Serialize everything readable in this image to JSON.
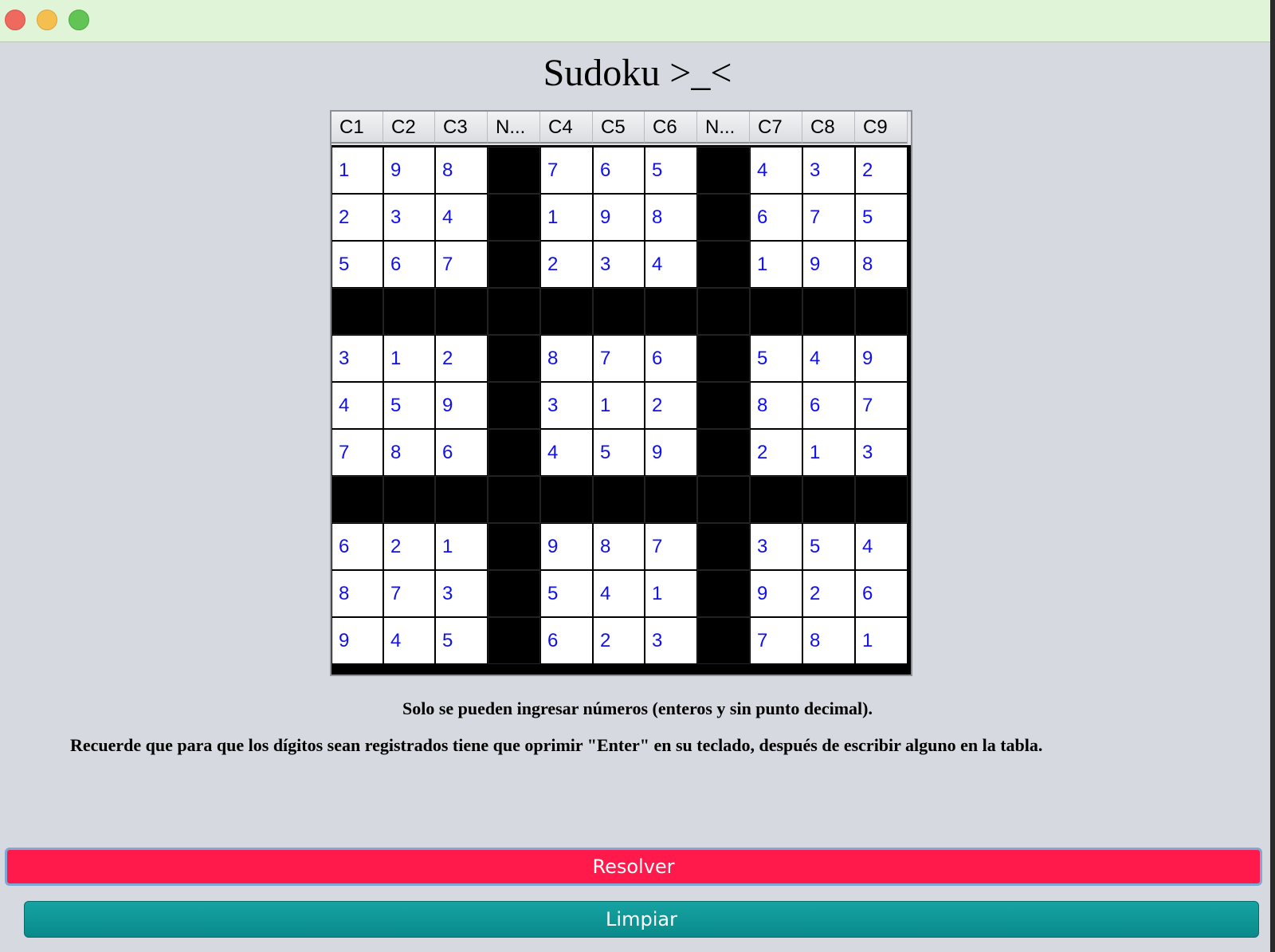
{
  "window": {
    "controls": [
      "close-icon",
      "minimize-icon",
      "maximize-icon"
    ]
  },
  "app_title": "Sudoku >_<",
  "table": {
    "headers": [
      "C1",
      "C2",
      "C3",
      "N...",
      "C4",
      "C5",
      "C6",
      "N...",
      "C7",
      "C8",
      "C9"
    ],
    "rows": [
      [
        "1",
        "9",
        "8",
        "7",
        "6",
        "5",
        "4",
        "3",
        "2"
      ],
      [
        "2",
        "3",
        "4",
        "1",
        "9",
        "8",
        "6",
        "7",
        "5"
      ],
      [
        "5",
        "6",
        "7",
        "2",
        "3",
        "4",
        "1",
        "9",
        "8"
      ],
      [
        "3",
        "1",
        "2",
        "8",
        "7",
        "6",
        "5",
        "4",
        "9"
      ],
      [
        "4",
        "5",
        "9",
        "3",
        "1",
        "2",
        "8",
        "6",
        "7"
      ],
      [
        "7",
        "8",
        "6",
        "4",
        "5",
        "9",
        "2",
        "1",
        "3"
      ],
      [
        "6",
        "2",
        "1",
        "9",
        "8",
        "7",
        "3",
        "5",
        "4"
      ],
      [
        "8",
        "7",
        "3",
        "5",
        "4",
        "1",
        "9",
        "2",
        "6"
      ],
      [
        "9",
        "4",
        "5",
        "6",
        "2",
        "3",
        "7",
        "8",
        "1"
      ]
    ]
  },
  "notes": {
    "line1": "Solo se pueden ingresar números (enteros y sin punto decimal).",
    "line2": "Recuerde que para que los dígitos sean registrados tiene que oprimir \"Enter\" en su teclado, después de escribir alguno en la tabla."
  },
  "buttons": {
    "resolver": "Resolver",
    "limpiar": "Limpiar"
  },
  "colors": {
    "resolver": "#ff1a4b",
    "limpiar": "#0f9a9a",
    "digits": "#1010ee"
  }
}
